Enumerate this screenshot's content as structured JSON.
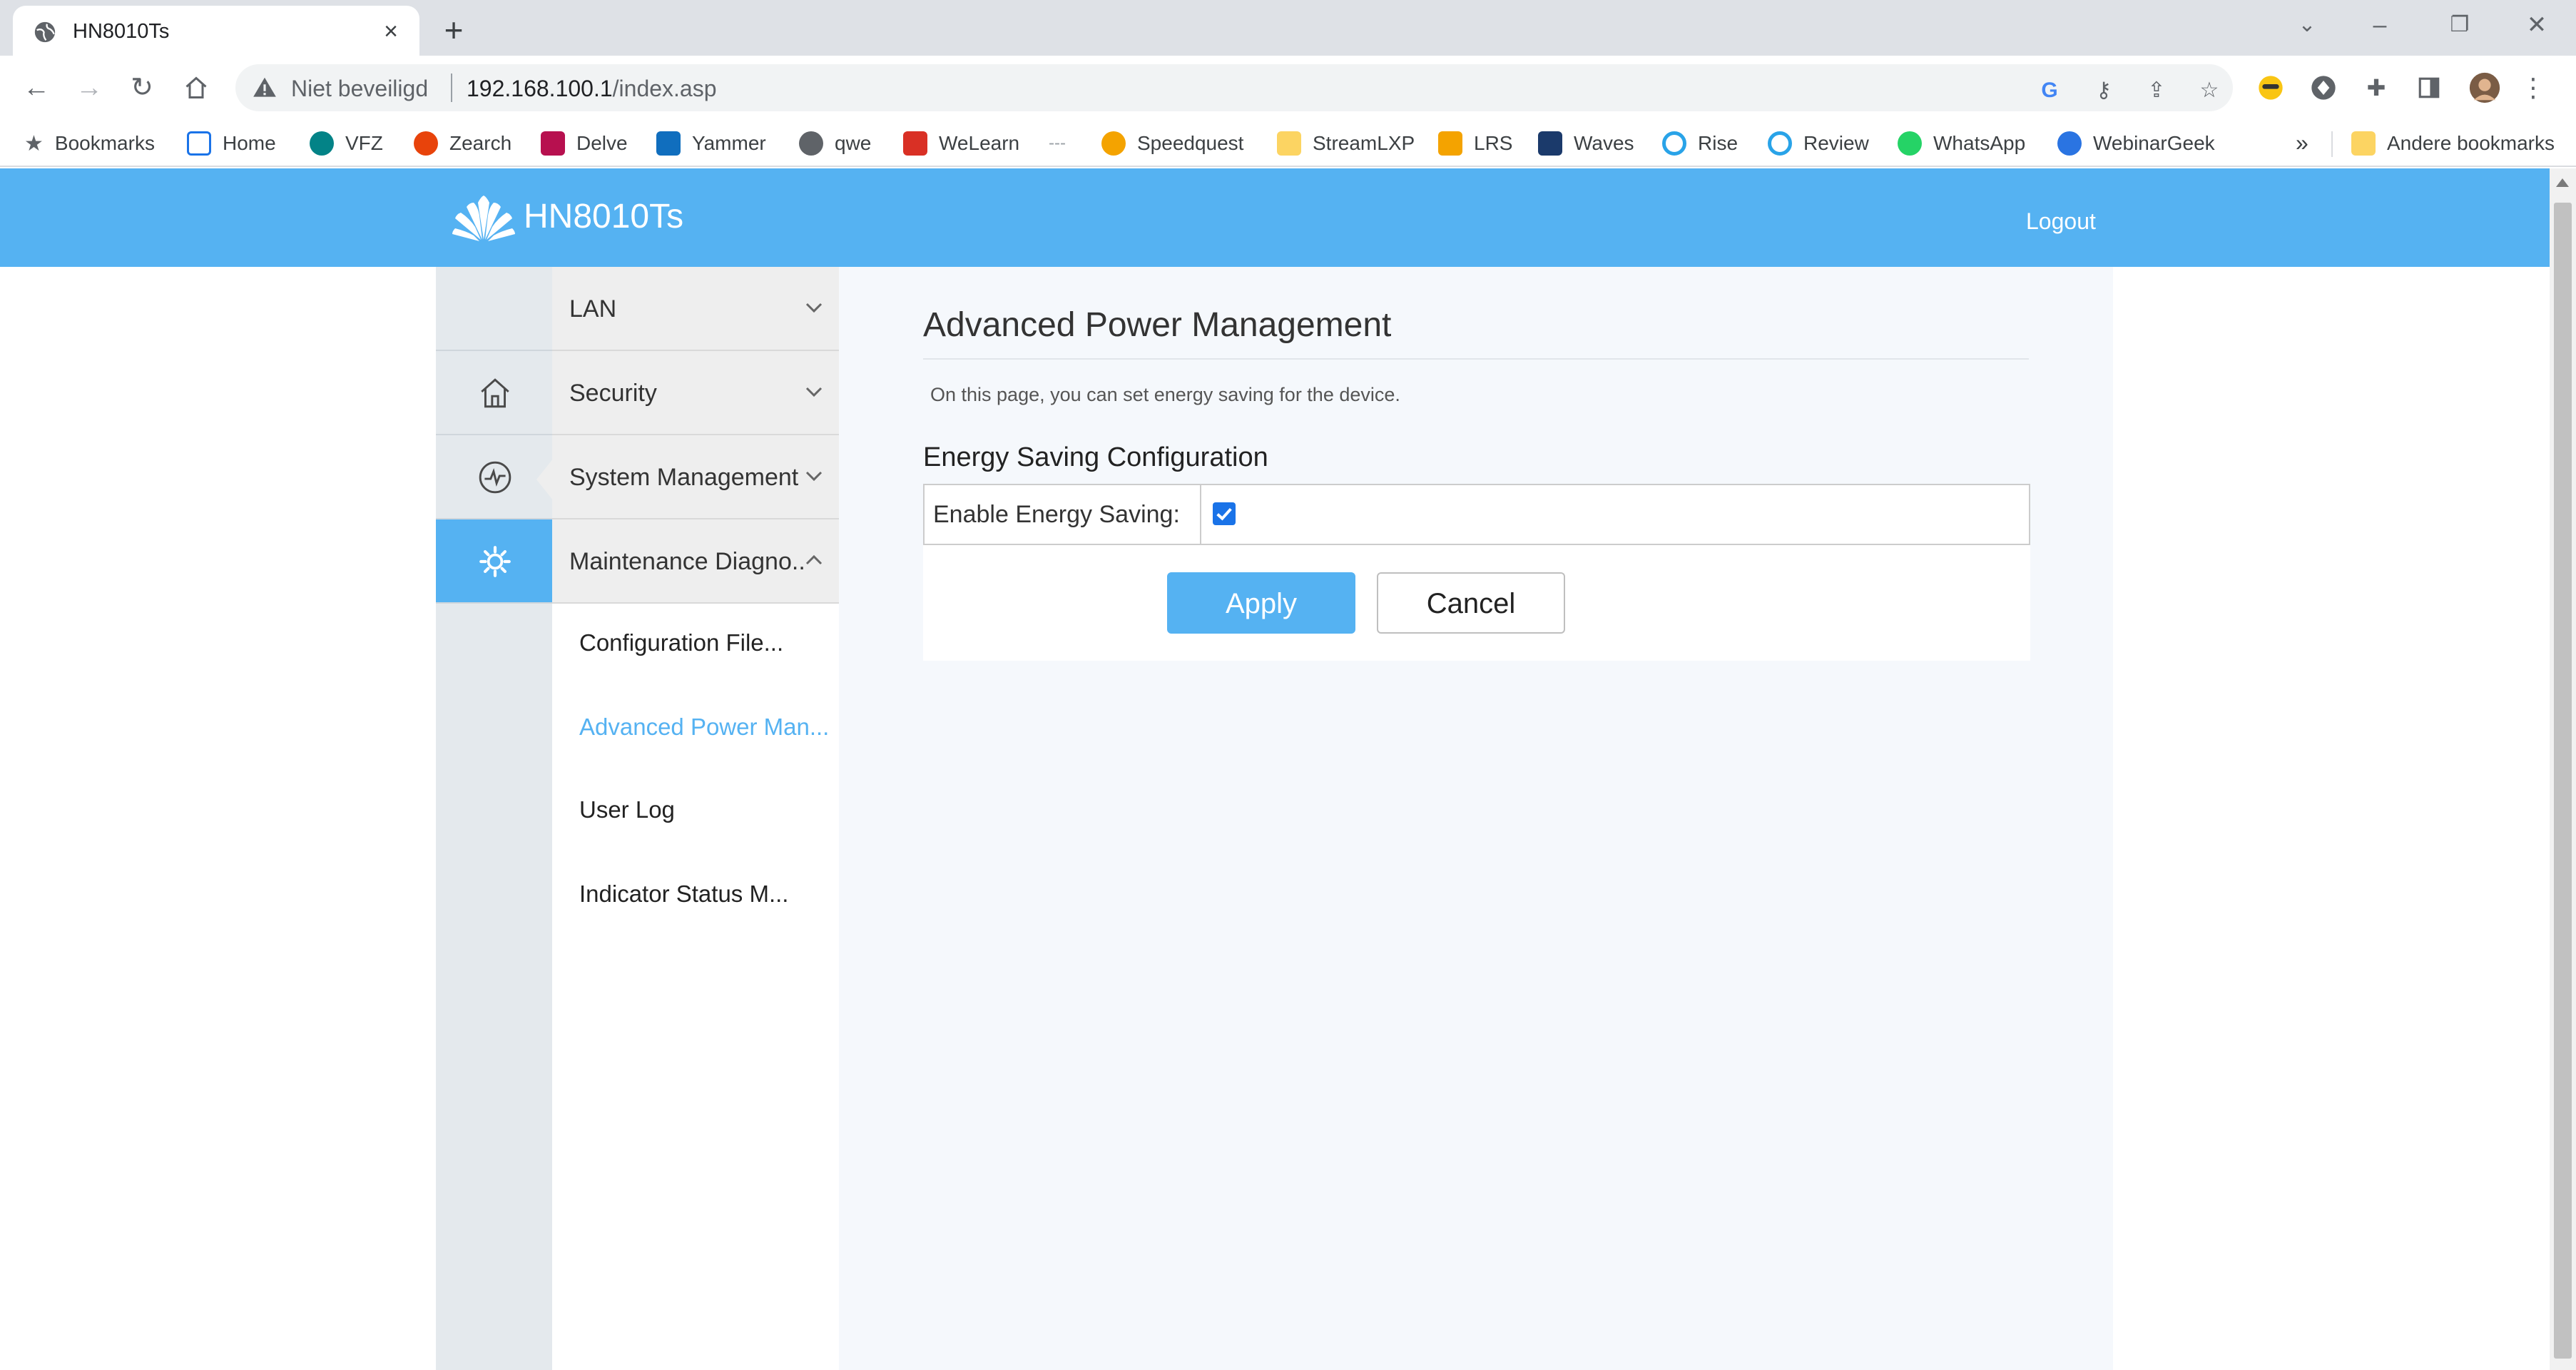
{
  "browser": {
    "tab_title": "HN8010Ts",
    "security_text": "Niet beveiligd",
    "url_host": "192.168.100.1",
    "url_path": "/index.asp",
    "bookmarks": [
      {
        "label": "Bookmarks",
        "color": "#5f6368"
      },
      {
        "label": "Home",
        "color": "#1a73e8"
      },
      {
        "label": "VFZ",
        "color": "#038387"
      },
      {
        "label": "Zearch",
        "color": "#e8430b"
      },
      {
        "label": "Delve",
        "color": "#b7104f"
      },
      {
        "label": "Yammer",
        "color": "#106ebe"
      },
      {
        "label": "qwe",
        "color": "#5f6368"
      },
      {
        "label": "WeLearn",
        "color": "#d93025"
      },
      {
        "label": "Speedquest",
        "color": "#f4a300"
      },
      {
        "label": "StreamLXP",
        "color": "#fcd462"
      },
      {
        "label": "LRS",
        "color": "#f4a300"
      },
      {
        "label": "Waves",
        "color": "#1b3a6b"
      },
      {
        "label": "Rise",
        "color": "#29a3e8"
      },
      {
        "label": "Review",
        "color": "#29a3e8"
      },
      {
        "label": "WhatsApp",
        "color": "#25d366"
      },
      {
        "label": "WebinarGeek",
        "color": "#2a74e2"
      }
    ],
    "other_bookmarks": "Andere bookmarks",
    "more_glyph": "»"
  },
  "header": {
    "brand": "HN8010Ts",
    "logout": "Logout",
    "color": "#55b2f2"
  },
  "menu": {
    "items": [
      {
        "label": "LAN",
        "expanded": false
      },
      {
        "label": "Security",
        "expanded": false
      },
      {
        "label": "System Management",
        "expanded": false
      },
      {
        "label": "Maintenance Diagno..",
        "expanded": true
      }
    ],
    "sub_items": [
      {
        "label": "Configuration File...",
        "active": false
      },
      {
        "label": "Advanced Power Man...",
        "active": true
      },
      {
        "label": "User Log",
        "active": false
      },
      {
        "label": "Indicator Status M...",
        "active": false
      }
    ]
  },
  "icons": [
    "home-icon",
    "activity-icon",
    "settings-gear-icon"
  ],
  "content": {
    "title": "Advanced Power Management",
    "description": "On this page, you can set energy saving for the device.",
    "section_title": "Energy Saving Configuration",
    "field_label": "Enable Energy Saving:",
    "energy_saving_enabled": true,
    "apply_label": "Apply",
    "cancel_label": "Cancel"
  }
}
